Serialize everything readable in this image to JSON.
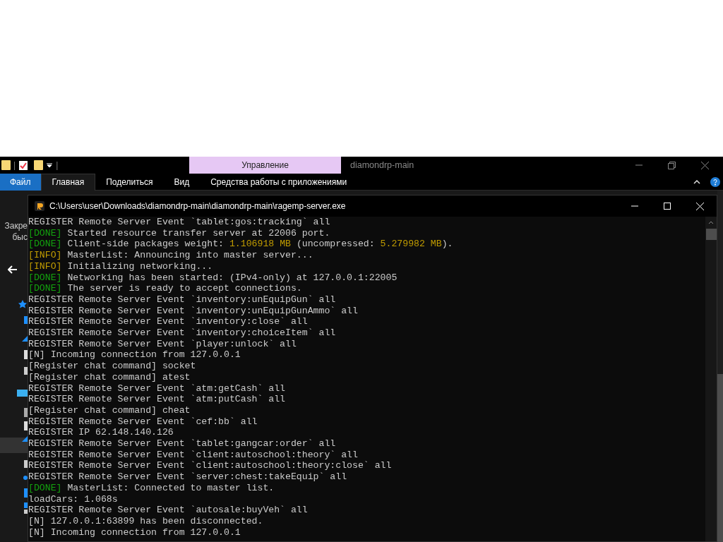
{
  "explorer": {
    "quick_access_labels": [
      "|",
      "|"
    ],
    "context_tab": "Управление",
    "title": "diamondrp-main",
    "ribbon_tabs": [
      {
        "label": "Файл",
        "selected": false,
        "kind": "file"
      },
      {
        "label": "Главная",
        "selected": true,
        "kind": "tab"
      },
      {
        "label": "Поделиться",
        "selected": false,
        "kind": "tab"
      },
      {
        "label": "Вид",
        "selected": false,
        "kind": "tab"
      },
      {
        "label": "Средства работы с приложениями",
        "selected": false,
        "kind": "tab"
      }
    ],
    "pane_text": [
      "Закре",
      "быс"
    ]
  },
  "console": {
    "title": "C:\\Users\\user\\Downloads\\diamondrp-main\\diamondrp-main\\ragemp-server.exe",
    "lines": [
      [
        {
          "text": "REGISTER Remote Server Event `tablet:gos:tracking` all",
          "kind": "plain"
        }
      ],
      [
        {
          "text": "[DONE]",
          "kind": "done"
        },
        {
          "text": " Started resource transfer server at 22006 port.",
          "kind": "plain"
        }
      ],
      [
        {
          "text": "[DONE]",
          "kind": "done"
        },
        {
          "text": " Client-side packages weight: ",
          "kind": "plain"
        },
        {
          "text": "1.106918 MB",
          "kind": "value"
        },
        {
          "text": " (uncompressed: ",
          "kind": "plain"
        },
        {
          "text": "5.279982 MB",
          "kind": "value"
        },
        {
          "text": ").",
          "kind": "plain"
        }
      ],
      [
        {
          "text": "[INFO]",
          "kind": "info"
        },
        {
          "text": " MasterList: Announcing into master server...",
          "kind": "plain"
        }
      ],
      [
        {
          "text": "[INFO]",
          "kind": "info"
        },
        {
          "text": " Initializing networking...",
          "kind": "plain"
        }
      ],
      [
        {
          "text": "[DONE]",
          "kind": "done"
        },
        {
          "text": " Networking has been started: (IPv4-only) at 127.0.0.1:22005",
          "kind": "plain"
        }
      ],
      [
        {
          "text": "[DONE]",
          "kind": "done"
        },
        {
          "text": " The server is ready to accept connections.",
          "kind": "plain"
        }
      ],
      [
        {
          "text": "REGISTER Remote Server Event `inventory:unEquipGun` all",
          "kind": "plain"
        }
      ],
      [
        {
          "text": "REGISTER Remote Server Event `inventory:unEquipGunAmmo` all",
          "kind": "plain"
        }
      ],
      [
        {
          "text": "REGISTER Remote Server Event `inventory:close` all",
          "kind": "plain"
        }
      ],
      [
        {
          "text": "REGISTER Remote Server Event `inventory:choiceItem` all",
          "kind": "plain"
        }
      ],
      [
        {
          "text": "REGISTER Remote Server Event `player:unlock` all",
          "kind": "plain"
        }
      ],
      [
        {
          "text": "[N] Incoming connection from 127.0.0.1",
          "kind": "plain"
        }
      ],
      [
        {
          "text": "[Register chat command] socket",
          "kind": "plain"
        }
      ],
      [
        {
          "text": "[Register chat command] atest",
          "kind": "plain"
        }
      ],
      [
        {
          "text": "REGISTER Remote Server Event `atm:getCash` all",
          "kind": "plain"
        }
      ],
      [
        {
          "text": "REGISTER Remote Server Event `atm:putCash` all",
          "kind": "plain"
        }
      ],
      [
        {
          "text": "[Register chat command] cheat",
          "kind": "plain"
        }
      ],
      [
        {
          "text": "REGISTER Remote Server Event `cef:bb` all",
          "kind": "plain"
        }
      ],
      [
        {
          "text": "REGISTER IP 62.148.140.126",
          "kind": "plain"
        }
      ],
      [
        {
          "text": "REGISTER Remote Server Event `tablet:gangcar:order` all",
          "kind": "plain"
        }
      ],
      [
        {
          "text": "REGISTER Remote Server Event `client:autoschool:theory` all",
          "kind": "plain"
        }
      ],
      [
        {
          "text": "REGISTER Remote Server Event `client:autoschool:theory:close` all",
          "kind": "plain"
        }
      ],
      [
        {
          "text": "REGISTER Remote Server Event `server:chest:takeEquip` all",
          "kind": "plain"
        }
      ],
      [
        {
          "text": "[DONE]",
          "kind": "done"
        },
        {
          "text": " MasterList: Connected to master list.",
          "kind": "plain"
        }
      ],
      [
        {
          "text": "loadCars: 1.068s",
          "kind": "plain"
        }
      ],
      [
        {
          "text": "REGISTER Remote Server Event `autosale:buyVeh` all",
          "kind": "plain"
        }
      ],
      [
        {
          "text": "[N] 127.0.0.1:63899 has been disconnected.",
          "kind": "plain"
        }
      ],
      [
        {
          "text": "[N] Incoming connection from 127.0.0.1",
          "kind": "plain"
        }
      ]
    ]
  }
}
